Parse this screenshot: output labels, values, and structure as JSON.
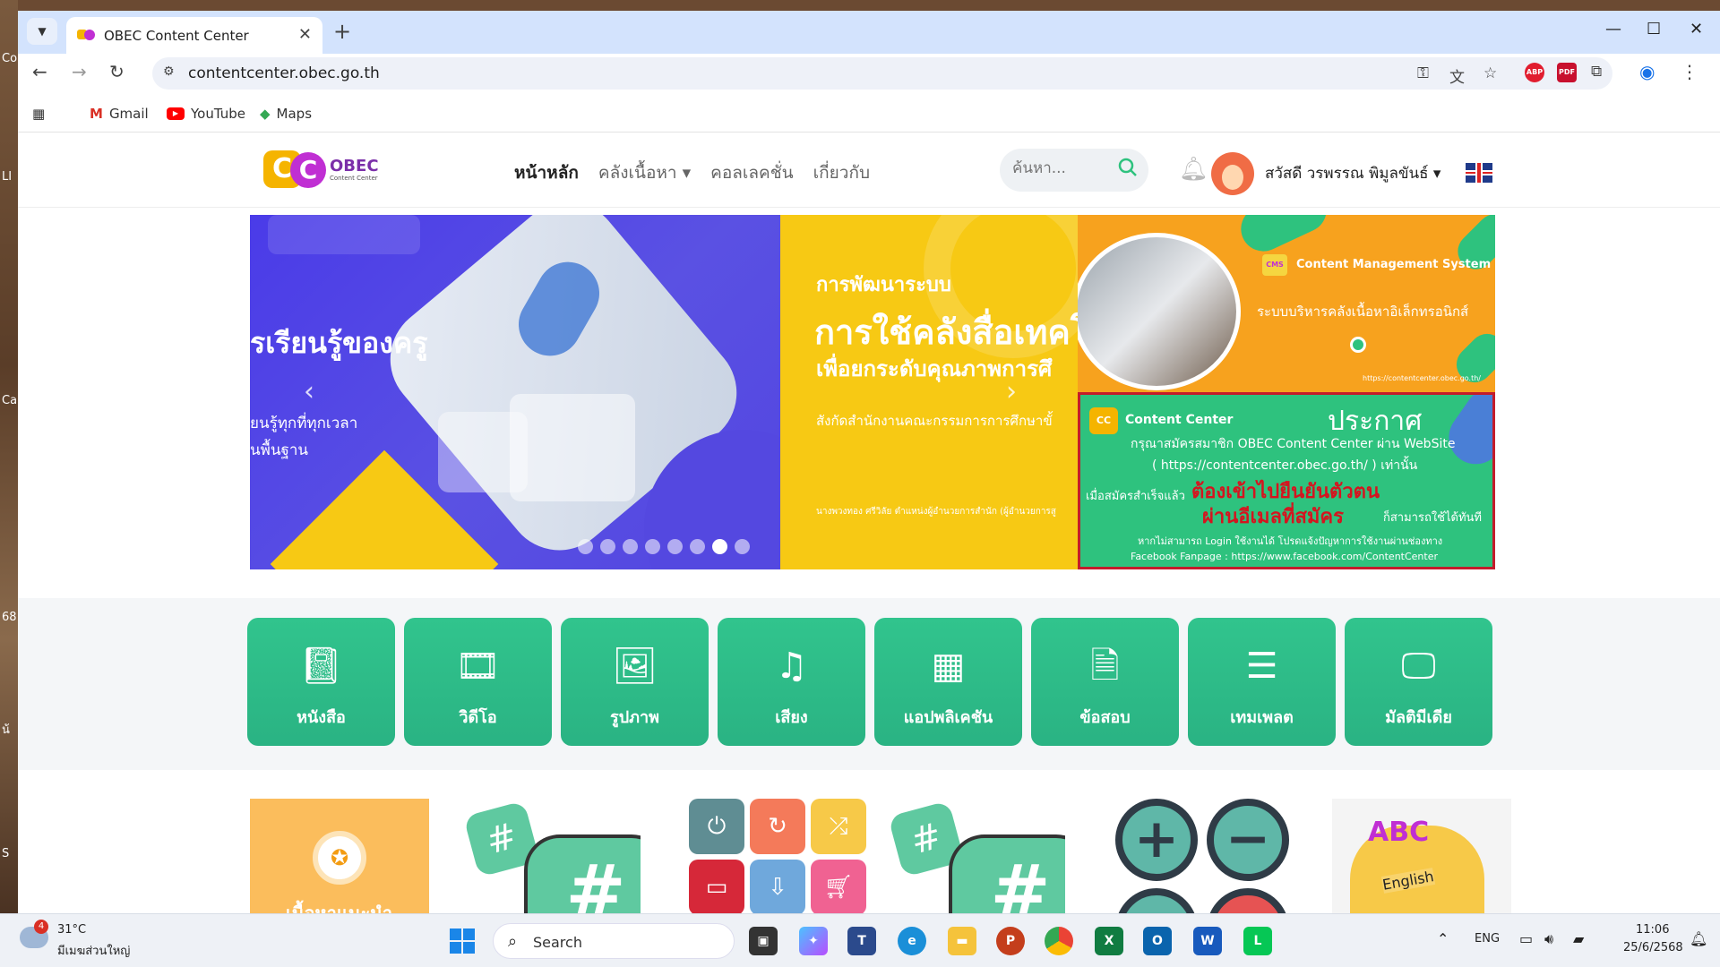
{
  "desktop": {
    "side_labels": [
      "Co",
      "LI",
      "Ca",
      "68",
      "น้",
      "S"
    ]
  },
  "browser": {
    "tab": {
      "title": "OBEC Content Center"
    },
    "new_tab": "+",
    "url": "contentcenter.obec.go.th",
    "bookmarks": [
      {
        "label": "Gmail",
        "icon": "gmail-icon"
      },
      {
        "label": "YouTube",
        "icon": "youtube-icon"
      },
      {
        "label": "Maps",
        "icon": "maps-icon"
      }
    ],
    "extensions": [
      {
        "label": "ABP",
        "color": "#e11d2f"
      },
      {
        "label": "PDF",
        "color": "#c8102e"
      }
    ]
  },
  "site": {
    "logo": {
      "mark_left": "C",
      "mark_right": "C",
      "name": "OBEC",
      "tagline": "Content Center"
    },
    "menu": [
      {
        "label": "หน้าหลัก",
        "active": true
      },
      {
        "label": "คลังเนื้อหา ▾",
        "active": false
      },
      {
        "label": "คอลเลคชั่น",
        "active": false
      },
      {
        "label": "เกี่ยวกับ",
        "active": false
      }
    ],
    "search": {
      "placeholder": "ค้นหา..."
    },
    "greeting": "สวัสดี วรพรรณ พิมูลขันธ์ ▾",
    "colors": {
      "accent": "#2ec27e",
      "brand_purple": "#7b2fa9",
      "brand_yellow": "#f5b400"
    }
  },
  "carousel": {
    "slide1": {
      "heading": "รเรียนรู้ของครู",
      "sub_line1": "ยนรู้ทุกที่ทุกเวลา",
      "sub_line2": "นพื้นฐาน"
    },
    "slide2": {
      "line1": "การพัฒนาระบบ",
      "line2": "การใช้คลังสื่อเทคโ",
      "line3": "เพื่อยกระดับคุณภาพการศึ",
      "line4": "สังกัดสำนักงานคณะกรรมการการศึกษาขั้",
      "line5": "นางพวงทอง ศรีวิลัย ตำแหน่งผู้อำนวยการสำนัก (ผู้อำนวยการสู"
    },
    "prev": "‹",
    "next": "›",
    "dots_count": 8,
    "active_dot": 7
  },
  "cms_panel": {
    "badge": "CMS",
    "title": "Content Management System",
    "subtitle": "ระบบบริหารคลังเนื้อหาอิเล็กทรอนิกส์",
    "url": "https://contentcenter.obec.go.th/"
  },
  "announcement": {
    "badge": "CC",
    "brand": "Content Center",
    "title": "ประกาศ",
    "line1": "กรุณาสมัครสมาชิก OBEC Content Center ผ่าน WebSite",
    "line2": "( https://contentcenter.obec.go.th/ ) เท่านั้น",
    "line3_prefix": "เมื่อสมัครสำเร็จแล้ว",
    "line3_emphasis": "ต้องเข้าไปยืนยันตัวตน",
    "line4_emphasis": "ผ่านอีเมลที่สมัคร",
    "line4_suffix": "ก็สามารถใช้ได้ทันที",
    "line5": "หากไม่สามารถ Login ใช้งานได้ โปรดแจ้งปัญหาการใช้งานผ่านช่องทาง",
    "line6": "Facebook Fanpage : https://www.facebook.com/ContentCenter"
  },
  "categories": [
    {
      "label": "หนังสือ",
      "icon": "book-icon"
    },
    {
      "label": "วิดีโอ",
      "icon": "film-icon"
    },
    {
      "label": "รูปภาพ",
      "icon": "image-icon"
    },
    {
      "label": "เสียง",
      "icon": "music-icon"
    },
    {
      "label": "แอปพลิเคชัน",
      "icon": "apps-icon"
    },
    {
      "label": "ข้อสอบ",
      "icon": "document-icon"
    },
    {
      "label": "เทมเพลต",
      "icon": "list-icon"
    },
    {
      "label": "มัลติมีเดีย",
      "icon": "multimedia-icon"
    }
  ],
  "content_cards": {
    "recommended_label": "เนื้อหาแนะนำ",
    "english_label": "English"
  },
  "taskbar": {
    "weather": {
      "temp": "31°C",
      "desc": "มีเมฆส่วนใหญ่",
      "alerts": "4"
    },
    "search_label": "Search",
    "language": "ENG",
    "time": "11:06",
    "date": "25/6/2568"
  }
}
